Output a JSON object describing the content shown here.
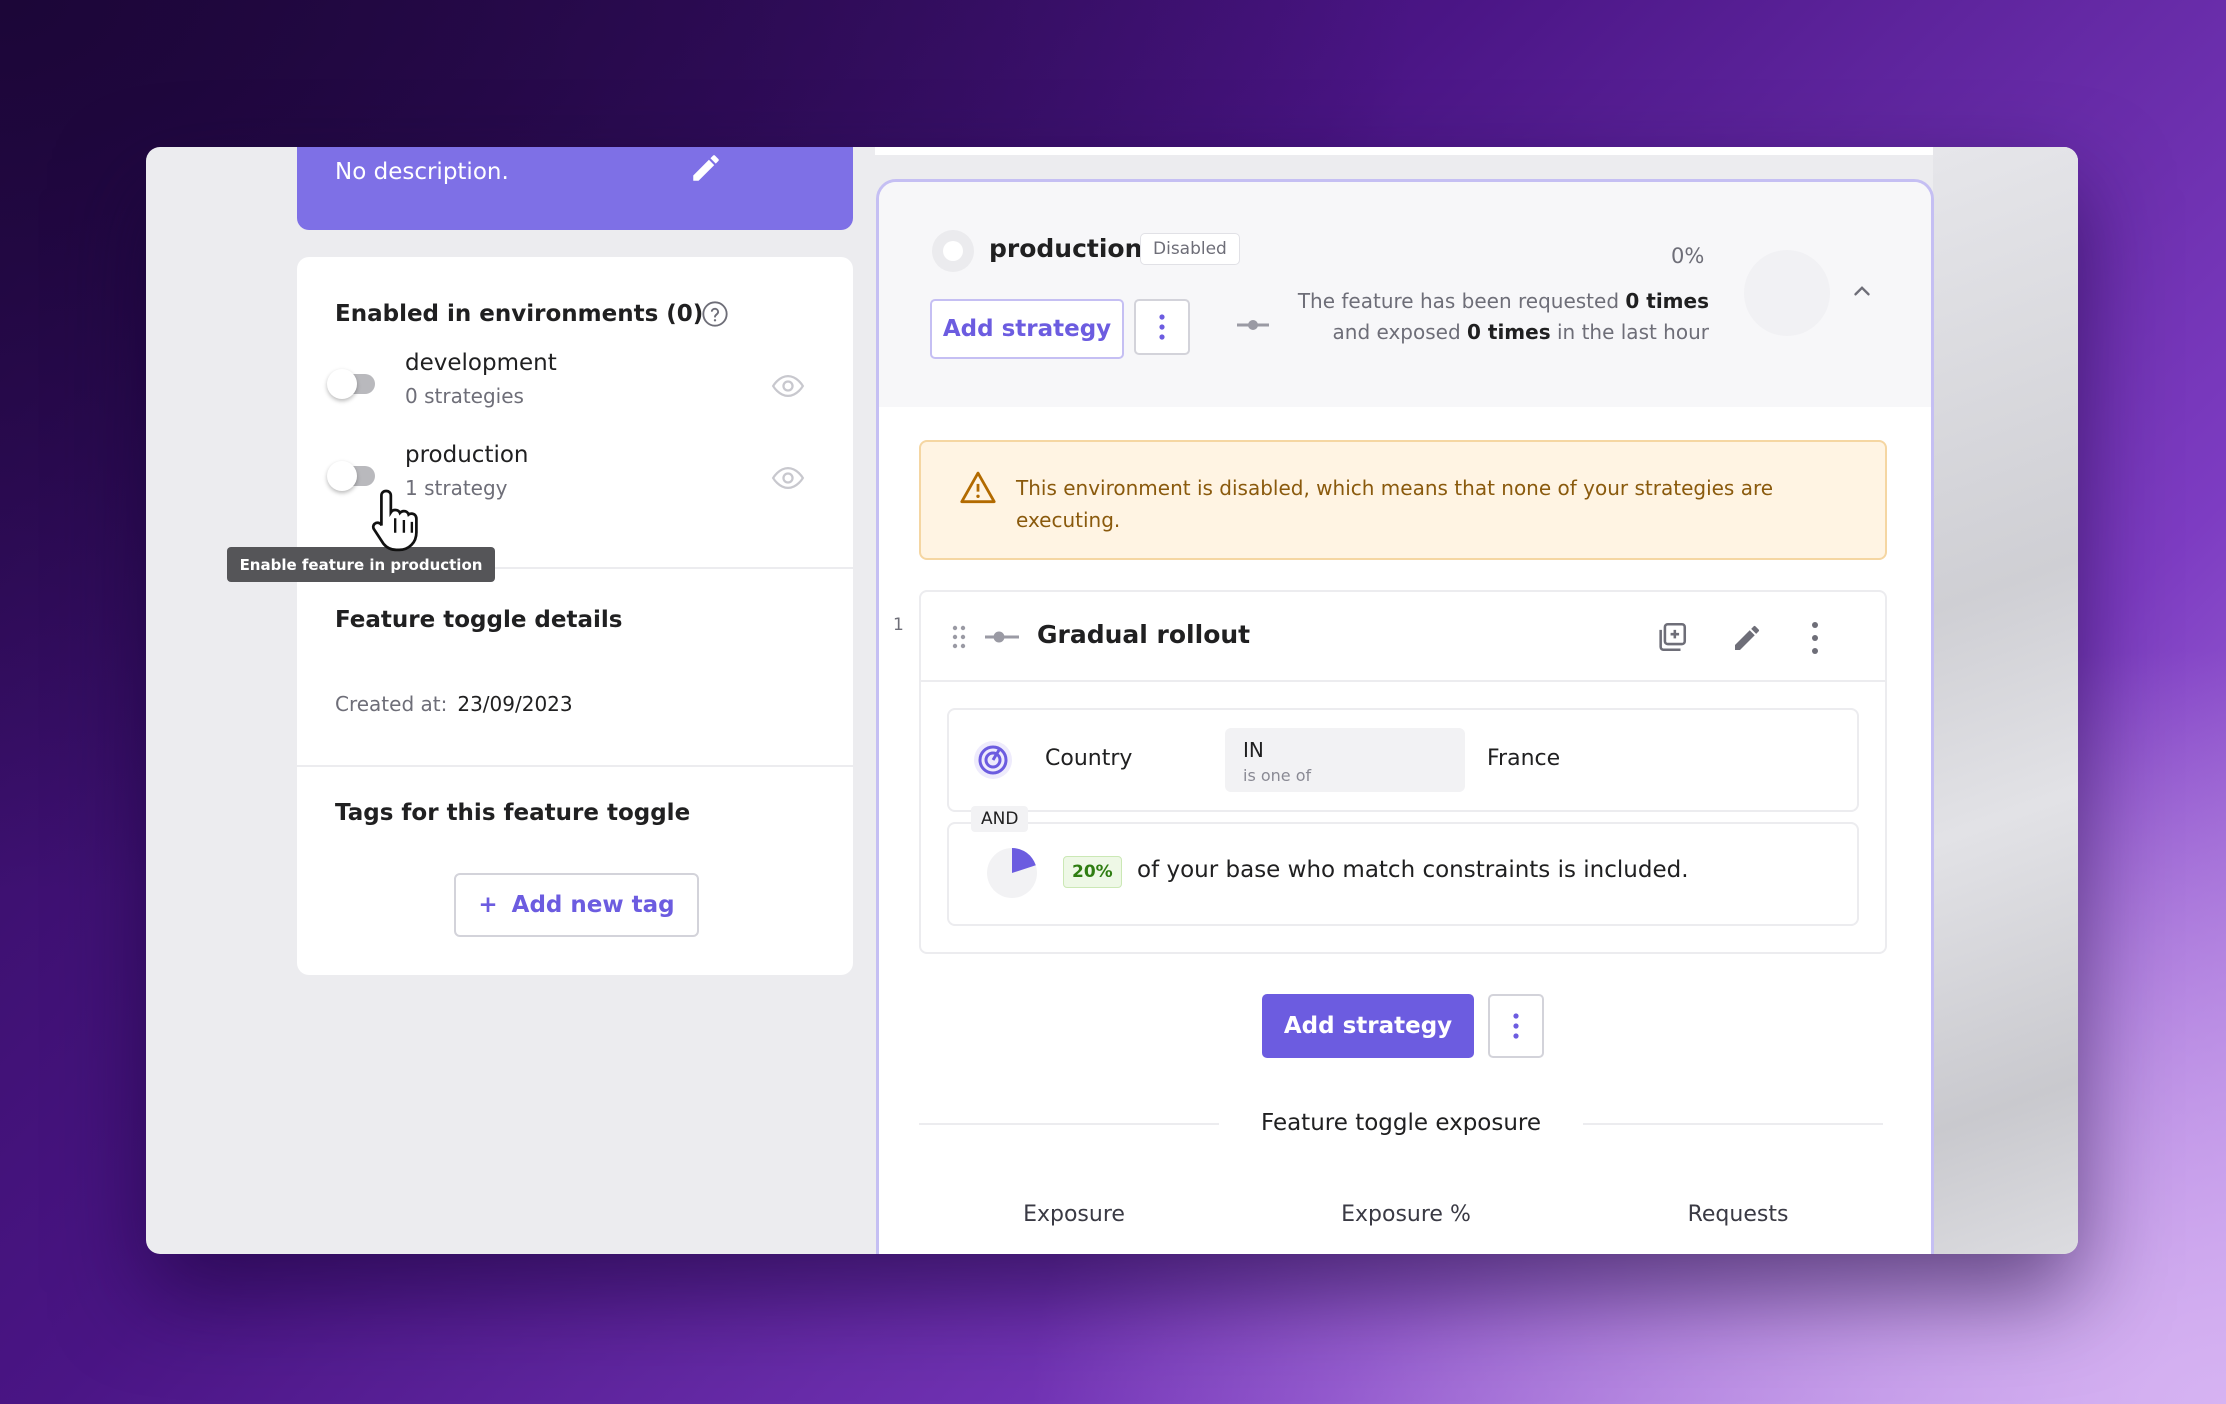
{
  "description": {
    "text": "No description.",
    "edit_icon": "pencil-icon"
  },
  "environments": {
    "title": "Enabled in environments (0)",
    "items": [
      {
        "name": "development",
        "sub": "0 strategies",
        "enabled": false
      },
      {
        "name": "production",
        "sub": "1 strategy",
        "enabled": false
      }
    ],
    "tooltip": "Enable feature in production"
  },
  "details": {
    "title": "Feature toggle details",
    "created_label": "Created at:",
    "created_value": "23/09/2023"
  },
  "tags": {
    "title": "Tags for this feature toggle",
    "add_label": "Add new tag"
  },
  "env_panel": {
    "name": "production",
    "status": "Disabled",
    "percent": "0%",
    "req_line1_pre": "The feature has been requested ",
    "req_line1_bold": "0 times",
    "req_line2_pre": "and exposed ",
    "req_line2_bold": "0 times",
    "req_line2_post": " in the last hour",
    "add_strategy": "Add strategy",
    "alert": "This environment is disabled, which means that none of your strategies are executing.",
    "strategy": {
      "index": "1",
      "title": "Gradual rollout",
      "constraint": {
        "field": "Country",
        "operator": "IN",
        "operator_sub": "is one of",
        "value": "France"
      },
      "joiner": "AND",
      "rollout_percent": "20%",
      "rollout_text": "of your base who match constraints is included."
    },
    "add_strategy_bottom": "Add strategy",
    "exposure_title": "Feature toggle exposure",
    "columns": [
      "Exposure",
      "Exposure %",
      "Requests"
    ]
  },
  "colors": {
    "accent": "#6c5ce0",
    "warning_bg": "#fff4e3",
    "description_bg": "#7e70e6"
  }
}
